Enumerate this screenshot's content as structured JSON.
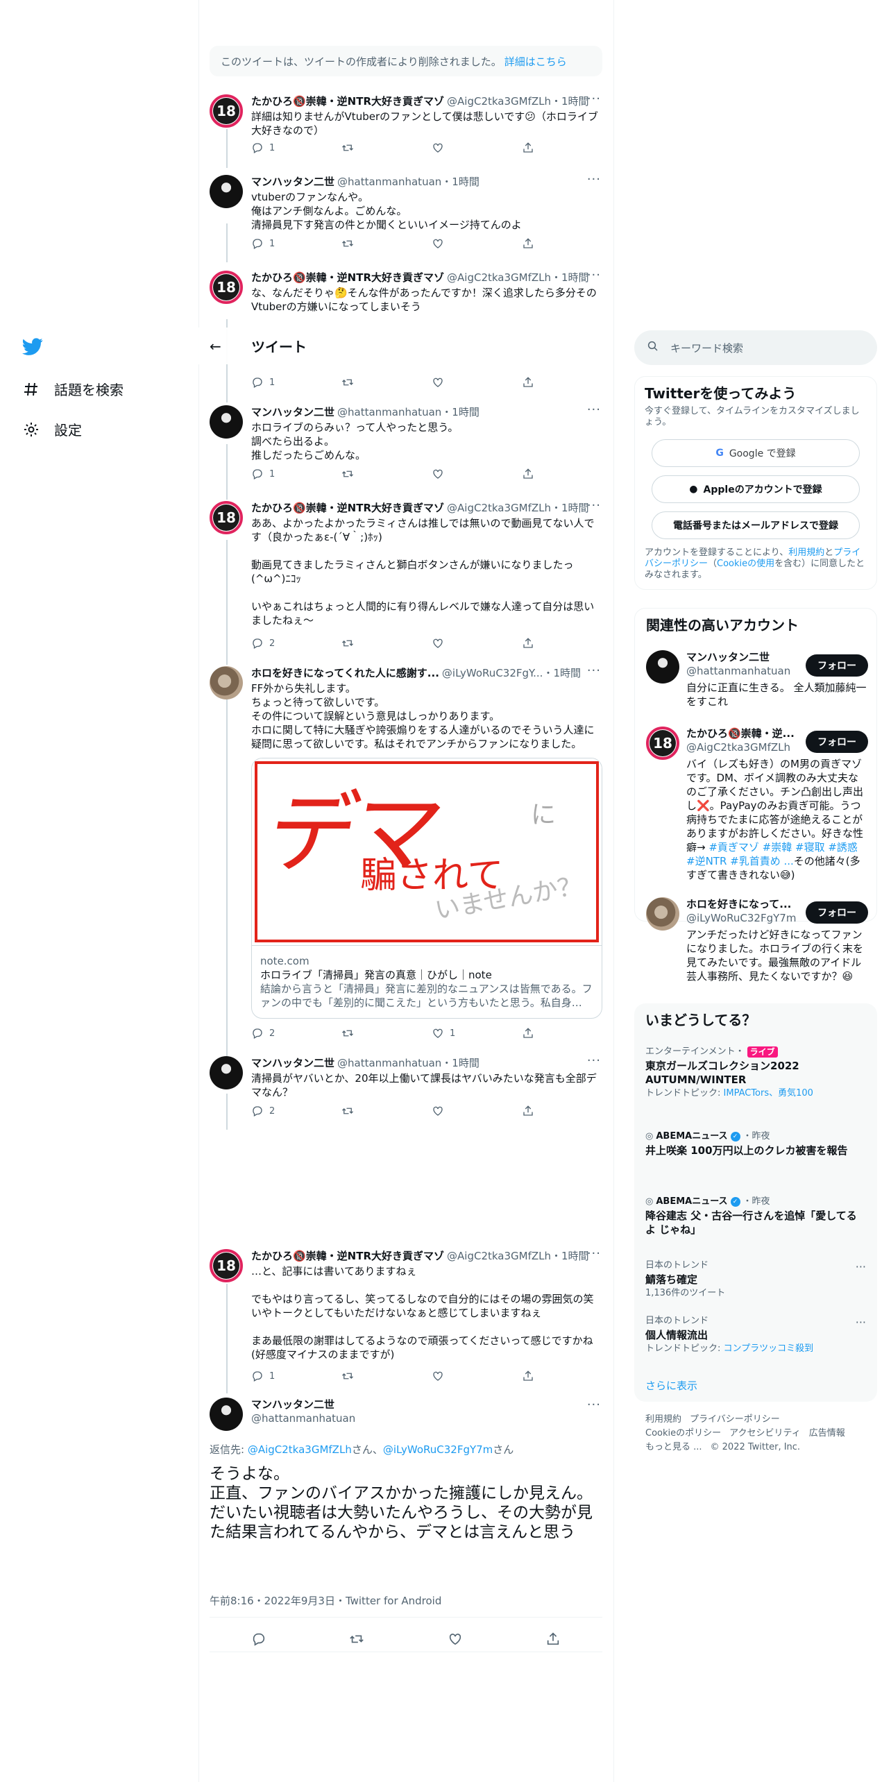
{
  "nav": {
    "explore_label": "話題を検索",
    "settings_label": "設定"
  },
  "header": {
    "title": "ツイート"
  },
  "deleted_notice": {
    "text": "このツイートは、ツイートの作成者により削除されました。",
    "link": "詳細はこちら"
  },
  "tweets": [
    {
      "name": "たかひろ🔞崇韓・逆NTR大好き貢ぎマゾ",
      "handle": "@AigC2tka3GMfZLh",
      "time": "・1時間",
      "text": "詳細は知りませんがVtuberのファンとして僕は悲しいです😕（ホロライブ大好きなので）",
      "replies": "1",
      "retweets": "",
      "likes": ""
    },
    {
      "name": "マンハッタン二世",
      "handle": "@hattanmanhatuan",
      "time": "・1時間",
      "text": "vtuberのファンなんや。\n俺はアンチ側なんよ。ごめんな。\n清掃員見下す発言の件とか聞くといいイメージ持てんのよ",
      "replies": "1",
      "retweets": "",
      "likes": ""
    },
    {
      "name": "たかひろ🔞崇韓・逆NTR大好き貢ぎマゾ",
      "handle": "@AigC2tka3GMfZLh",
      "time": "・1時間",
      "text": "な、なんだそりゃ🤔そんな件があったんですか！深く追求したら多分そのVtuberの方嫌いになってしまいそう",
      "replies": "1",
      "retweets": "",
      "likes": ""
    },
    {
      "name": "マンハッタン二世",
      "handle": "@hattanmanhatuan",
      "time": "・1時間",
      "text": "ホロライブのらみぃ？って人やったと思う。\n調べたら出るよ。\n推しだったらごめんな。",
      "replies": "1",
      "retweets": "",
      "likes": ""
    },
    {
      "name": "たかひろ🔞崇韓・逆NTR大好き貢ぎマゾ",
      "handle": "@AigC2tka3GMfZLh",
      "time": "・1時間",
      "text": "ああ、よかったよかったラミィさんは推しでは無いので動画見てない人です（良かったぁε-(´∀｀;)ﾎｯ)\n\n動画見てきましたラミィさんと獅白ボタンさんが嫌いになりましたっ(^ω^)ﾆｺｯ\n\nいやぁこれはちょっと人間的に有り得んレベルで嫌な人達って自分は思いましたねぇ〜",
      "replies": "2",
      "retweets": "",
      "likes": ""
    },
    {
      "name": "ホロを好きになってくれた人に感謝す...",
      "handle": "@iLyWoRuC32FgY...",
      "time": "・1時間",
      "text": "FF外から失礼します。\nちょっと待って欲しいです。\nその件について誤解という意見はしっかりあります。\nホロに関して特に大騒ぎや誇張煽りをする人達がいるのでそういう人達に疑問に思って欲しいです。私はそれでアンチからファンになりました。",
      "replies": "2",
      "retweets": "",
      "likes": "1",
      "card": {
        "domain": "note.com",
        "title": "ホロライブ「清掃員」発言の真意｜ひがし｜note",
        "desc": "結論から言うと「清掃員」発言に差別的なニュアンスは皆無である。ファンの中でも「差別的に聞こえた」という方もいたと思う。私自身…",
        "img_text1": "デマ",
        "img_text2": "に",
        "img_text3": "騙されて",
        "img_text4": "いませんか？"
      }
    },
    {
      "name": "マンハッタン二世",
      "handle": "@hattanmanhatuan",
      "time": "・1時間",
      "text": "清掃員がヤバいとか、20年以上働いて課長はヤバいみたいな発言も全部デマなん？",
      "replies": "2",
      "retweets": "",
      "likes": ""
    },
    {
      "name": "たかひろ🔞崇韓・逆NTR大好き貢ぎマゾ",
      "handle": "@AigC2tka3GMfZLh",
      "time": "・1時間",
      "text": "…と、記事には書いてありますねぇ\n\nでもやはり言ってるし、笑ってるしなので自分的にはその場の雰囲気の笑いやトークとしてもいただけないなぁと感じてしまいますねぇ\n\nまあ最低限の謝罪はしてるようなので頑張ってくださいって感じですかね(好感度マイナスのままですが)",
      "replies": "1",
      "retweets": "",
      "likes": ""
    }
  ],
  "focus": {
    "name": "マンハッタン二世",
    "handle": "@hattanmanhatuan",
    "reply_prefix": "返信先: ",
    "reply_user1": "@AigC2tka3GMfZLh",
    "reply_mid": "さん、",
    "reply_user2": "@iLyWoRuC32FgY7m",
    "reply_suffix": "さん",
    "text": "そうよな。\n正直、ファンのバイアスかかった擁護にしか見えん。\nだいたい視聴者は大勢いたんやろうし、その大勢が見た結果言われてるんやから、デマとは言えんと思う",
    "meta": "午前8:16・2022年9月3日・Twitter for Android"
  },
  "sidebar": {
    "search_placeholder": "キーワード検索",
    "signup": {
      "title": "Twitterを使ってみよう",
      "subtitle": "今すぐ登録して、タイムラインをカスタマイズしましょう。",
      "google": "Google で登録",
      "apple": "Appleのアカウントで登録",
      "phone": "電話番号またはメールアドレスで登録",
      "legal1": "アカウントを登録することにより、",
      "legal_link1": "利用規約",
      "legal2": "と",
      "legal_link2": "プライバシーポリシー",
      "legal3": "（",
      "legal_link3": "Cookieの使用",
      "legal4": "を含む）に同意したとみなされます。"
    },
    "related": {
      "title": "関連性の高いアカウント",
      "follow": "フォロー",
      "users": [
        {
          "name": "マンハッタン二世",
          "handle": "@hattanmanhatuan",
          "bio": "自分に正直に生きる。 全人類加藤純一をすこれ"
        },
        {
          "name": "たかひろ🔞崇韓・逆...",
          "handle": "@AigC2tka3GMfZLh",
          "bio": "バイ（レズも好き）のM男の貢ぎマゾです。DM、ボイメ調教のみ大丈夫なのご了承ください。チン凸創出し声出し❌。PayPayのみお貢ぎ可能。うつ病持ちでたまに応答が途絶えることがありますがお許しください。好きな性癖→ ",
          "tags": "#貢ぎマゾ #崇韓 #寝取 #誘惑 #逆NTR #乳首責め ...",
          "bio_end": "その他諸々(多すぎて書ききれない😅)"
        },
        {
          "name": "ホロを好きになって...",
          "handle": "@iLyWoRuC32FgY7m",
          "bio": "アンチだったけど好きになってファンになりました。ホロライブの行く末を見てみたいです。最強無敵のアイドル芸人事務所、見たくないですか？😆"
        }
      ]
    },
    "trends": {
      "title": "いまどうしてる？",
      "items": [
        {
          "context": "エンターテインメント・",
          "live": "ライブ",
          "name": "東京ガールズコレクション2022 AUTUMN/WINTER",
          "sub": "トレンドトピック: ",
          "sub_link": "IMPACTors、勇気100"
        },
        {
          "context": "ABEMAニュース",
          "time": "・昨夜",
          "name": "井上咲楽 100万円以上のクレカ被害を報告"
        },
        {
          "context": "ABEMAニュース",
          "time": "・昨夜",
          "name": "降谷建志 父・古谷一行さんを追悼「愛してるよ じゃね」"
        },
        {
          "context": "日本のトレンド",
          "name": "鯖落ち確定",
          "sub": "1,136件のツイート"
        },
        {
          "context": "日本のトレンド",
          "name": "個人情報流出",
          "sub": "トレンドトピック: ",
          "sub_link": "コンプラツッコミ殺到"
        }
      ],
      "show_more": "さらに表示"
    },
    "footer": {
      "l1": "利用規約",
      "l2": "プライバシーポリシー",
      "l3": "Cookieのポリシー",
      "l4": "アクセシビリティ",
      "l5": "広告情報",
      "l6": "もっと見る ...",
      "l7": "© 2022 Twitter, Inc."
    }
  },
  "colors": {
    "accent": "#1d9bf0",
    "text": "#0f1419",
    "muted": "#536471",
    "border": "#eff3f4",
    "badge": "#e0245e"
  }
}
